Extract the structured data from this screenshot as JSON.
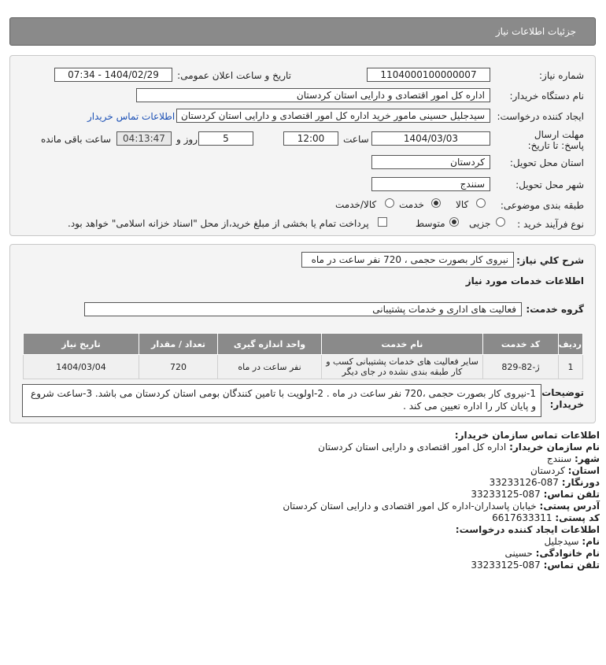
{
  "header": {
    "title": "جزئیات اطلاعات نیاز"
  },
  "form": {
    "need_number_label": "شماره نیاز:",
    "need_number": "1104000100000007",
    "announce_label": "تاریخ و ساعت اعلان عمومی:",
    "announce_value": "1404/02/29 - 07:34",
    "buyer_label": "نام دستگاه خریدار:",
    "buyer_value": "اداره کل امور اقتصادی و دارایی استان کردستان",
    "creator_label": "ایجاد کننده درخواست:",
    "creator_value": "سیدجلیل حسینی مامور خرید اداره کل امور اقتصادی و دارایی استان کردستان",
    "contact_link": "اطلاعات تماس خریدار",
    "deadline_label": "مهلت ارسال پاسخ: تا تاریخ:",
    "deadline_date": "1404/03/03",
    "time_label": "ساعت",
    "deadline_time": "12:00",
    "days_value": "5",
    "days_label": "روز و",
    "remaining_time": "04:13:47",
    "remaining_label": "ساعت باقی مانده",
    "province_label": "استان محل تحویل:",
    "province_value": "کردستان",
    "city_label": "شهر محل تحویل:",
    "city_value": "سنندج",
    "category_label": "طبقه بندی موضوعی:",
    "category_options": [
      "کالا",
      "خدمت",
      "کالا/خدمت"
    ],
    "process_label": "نوع فرآیند خرید :",
    "process_options": [
      "جزیی",
      "متوسط"
    ],
    "treasury_note": "پرداخت تمام یا بخشی از مبلغ خرید،از محل \"اسناد خزانه اسلامی\" خواهد بود."
  },
  "summary": {
    "label": "شرح کلي نياز:",
    "value": "نیروی کار بصورت حجمی ، 720 نفر ساعت در ماه",
    "services_title": "اطلاعات خدمات مورد نياز",
    "group_label": "گروه خدمت:",
    "group_value": "فعالیت های اداری و خدمات پشتیبانی"
  },
  "table": {
    "headers": [
      "ردیف",
      "کد خدمت",
      "نام خدمت",
      "واحد اندازه گیری",
      "تعداد / مقدار",
      "تاریخ نیاز"
    ],
    "rows": [
      [
        "1",
        "ژ-82-829",
        "سایر فعالیت های خدمات پشتیبانی کسب و کار طبقه بندی نشده در جای دیگر",
        "نفر ساعت در ماه",
        "720",
        "1404/03/04"
      ]
    ]
  },
  "buyer_notes": {
    "label": "توضیحات خریدار:",
    "text": "1-نیروی کار بصورت حجمی ،720 نفر ساعت در ماه . 2-اولویت با تامین کنندگان بومی استان کردستان می باشد. 3-ساعت شروع و پایان کار را اداره تعیین می کند ."
  },
  "contact": {
    "org_title": "اطلاعات تماس سازمان خریدار:",
    "org_name_label": "نام سازمان خریدار:",
    "org_name": "اداره کل امور اقتصادی و دارایی استان کردستان",
    "city_label": "شهر:",
    "city": "سنندج",
    "province_label": "استان:",
    "province": "کردستان",
    "fax_label": "دورنگار:",
    "fax": "087-33233126",
    "phone_label": "تلفن تماس:",
    "phone": "087-33233125",
    "address_label": "آدرس پستی:",
    "address": "خیابان پاسداران-اداره کل امور اقتصادی و دارایی استان کردستان",
    "postal_label": "کد پستی:",
    "postal": "6617633311",
    "creator_title": "اطلاعات ایجاد کننده درخواست:",
    "first_name_label": "نام:",
    "first_name": "سیدجلیل",
    "last_name_label": "نام خانوادگی:",
    "last_name": "حسینی",
    "creator_phone_label": "تلفن تماس:",
    "creator_phone": "087-33233125"
  }
}
